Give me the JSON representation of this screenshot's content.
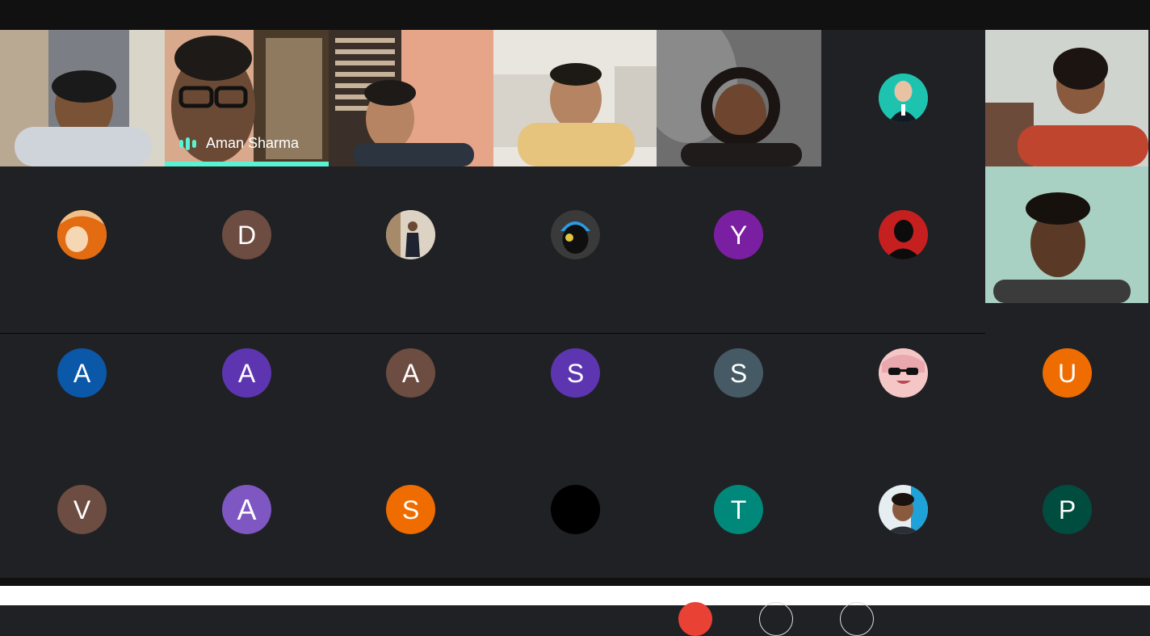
{
  "speaker": {
    "name": "Aman Sharma"
  },
  "tiles": [
    {
      "kind": "video",
      "id": "v1"
    },
    {
      "kind": "video",
      "id": "v2",
      "label": "Aman Sharma"
    },
    {
      "kind": "video",
      "id": "v3"
    },
    {
      "kind": "video",
      "id": "v4"
    },
    {
      "kind": "video",
      "id": "v5"
    }
  ],
  "avatars": {
    "row1": [
      {
        "type": "photo",
        "name": "profile-photo-teal",
        "color": "#1ec3b0"
      }
    ],
    "row2": [
      {
        "type": "photo",
        "name": "profile-photo-anime-orange",
        "color": "#e67b1f"
      },
      {
        "type": "initial",
        "letter": "D",
        "color": "#6d4c41"
      },
      {
        "type": "photo",
        "name": "profile-photo-suit",
        "color": "#c9c0b3"
      },
      {
        "type": "photo",
        "name": "profile-photo-skull-cap",
        "color": "#2b2b2b"
      },
      {
        "type": "initial",
        "letter": "Y",
        "color": "#7b1fa2"
      },
      {
        "type": "photo",
        "name": "profile-photo-silhouette-red",
        "color": "#c61f1f"
      }
    ],
    "row3": [
      {
        "type": "initial",
        "letter": "A",
        "color": "#0b57a8"
      },
      {
        "type": "initial",
        "letter": "A",
        "color": "#5e35b1"
      },
      {
        "type": "initial",
        "letter": "A",
        "color": "#6d4c41"
      },
      {
        "type": "initial",
        "letter": "S",
        "color": "#5e35b1"
      },
      {
        "type": "initial",
        "letter": "S",
        "color": "#455a64"
      },
      {
        "type": "photo",
        "name": "profile-photo-anime-sunglasses",
        "color": "#f1b8b8"
      },
      {
        "type": "initial",
        "letter": "U",
        "color": "#ef6c00"
      }
    ],
    "row4": [
      {
        "type": "initial",
        "letter": "V",
        "color": "#6d4c41"
      },
      {
        "type": "initial",
        "letter": "A",
        "color": "#7e57c2"
      },
      {
        "type": "initial",
        "letter": "S",
        "color": "#ef6c00"
      },
      {
        "type": "photo",
        "name": "profile-photo-black",
        "color": "#000000"
      },
      {
        "type": "initial",
        "letter": "T",
        "color": "#00897b"
      },
      {
        "type": "photo",
        "name": "profile-photo-man",
        "color": "#3a7ca5"
      },
      {
        "type": "initial",
        "letter": "P",
        "color": "#004d40"
      }
    ]
  },
  "colors": {
    "background": "#202124",
    "speaking": "#5af2d2"
  }
}
